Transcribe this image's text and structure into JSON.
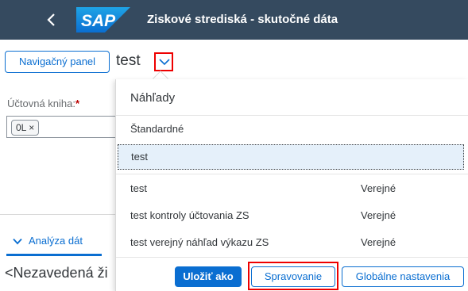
{
  "shell": {
    "title": "Ziskové strediská - skutočné dáta",
    "logo": "SAP",
    "back_icon": "chevron-left-icon"
  },
  "variant_bar": {
    "nav_panel_label": "Navigačný panel",
    "variant_name": "test",
    "toggle_icon": "chevron-down-icon"
  },
  "filter": {
    "ledger_label": "Účtovná kniha:",
    "required_mark": "*",
    "token": "0L ×"
  },
  "background": {
    "analysis_tab": "Analýza dát",
    "truncated_text": "<Nezavedená ži"
  },
  "popover": {
    "title": "Náhľady",
    "standard": "Štandardné",
    "selected": "test",
    "rows": [
      {
        "name": "test",
        "scope": "Verejné"
      },
      {
        "name": "test kontroly účtovania ZS",
        "scope": "Verejné"
      },
      {
        "name": "test verejný náhľad výkazu ZS",
        "scope": "Verejné"
      }
    ],
    "buttons": {
      "save_as": "Uložiť ako",
      "manage": "Spravovanie",
      "global_settings": "Globálne nastavenia"
    }
  },
  "colors": {
    "shell_bg": "#354a5f",
    "accent": "#0a6ed1",
    "highlight_frame": "#ee0000",
    "selected_row": "#e5f0fa"
  }
}
